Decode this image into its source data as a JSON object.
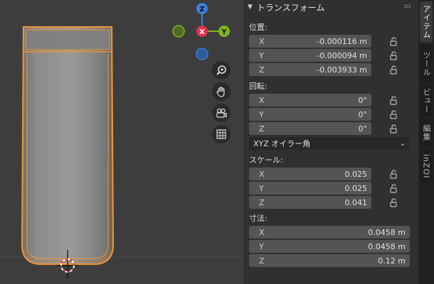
{
  "gizmo": {
    "z": "Z",
    "x": "X",
    "y": "Y"
  },
  "panel": {
    "title": "トランスフォーム",
    "location": {
      "label": "位置:",
      "x": {
        "axis": "X",
        "value": "-0.000116 m"
      },
      "y": {
        "axis": "Y",
        "value": "-0.000094 m"
      },
      "z": {
        "axis": "Z",
        "value": "-0.003933 m"
      }
    },
    "rotation": {
      "label": "回転:",
      "x": {
        "axis": "X",
        "value": "0°"
      },
      "y": {
        "axis": "Y",
        "value": "0°"
      },
      "z": {
        "axis": "Z",
        "value": "0°"
      }
    },
    "rotation_mode": "XYZ オイラー角",
    "scale": {
      "label": "スケール:",
      "x": {
        "axis": "X",
        "value": "0.025"
      },
      "y": {
        "axis": "Y",
        "value": "0.025"
      },
      "z": {
        "axis": "Z",
        "value": "0.041"
      }
    },
    "dimensions": {
      "label": "寸法:",
      "x": {
        "axis": "X",
        "value": "0.0458 m"
      },
      "y": {
        "axis": "Y",
        "value": "0.0458 m"
      },
      "z": {
        "axis": "Z",
        "value": "0.12 m"
      }
    }
  },
  "tabs": [
    "アイテム",
    "ツール",
    "ビュー",
    "編集",
    "inZOI"
  ],
  "colors": {
    "accent_orange": "#e8953a",
    "axis_x": "#e0314b",
    "axis_y": "#7fb521",
    "axis_z": "#3d7fdc"
  }
}
